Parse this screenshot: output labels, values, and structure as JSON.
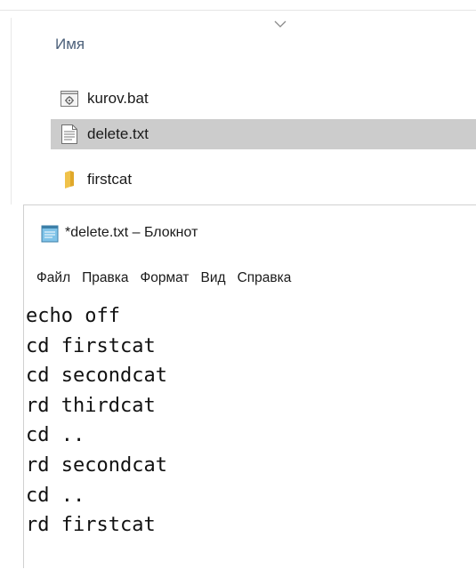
{
  "explorer": {
    "column_header": "Имя",
    "files": [
      {
        "name": "kurov.bat",
        "icon": "batch-file-icon",
        "selected": false
      },
      {
        "name": "delete.txt",
        "icon": "text-file-icon",
        "selected": true
      },
      {
        "name": "firstcat",
        "icon": "folder-icon",
        "selected": false
      }
    ],
    "selected_color": "#cccccc"
  },
  "notepad": {
    "title": "*delete.txt – Блокнот",
    "menu": [
      "Файл",
      "Правка",
      "Формат",
      "Вид",
      "Справка"
    ],
    "lines": [
      "echo off",
      "cd firstcat",
      "cd secondcat",
      "rd thirdcat",
      "cd ..",
      "rd secondcat",
      "cd ..",
      "rd firstcat"
    ]
  }
}
